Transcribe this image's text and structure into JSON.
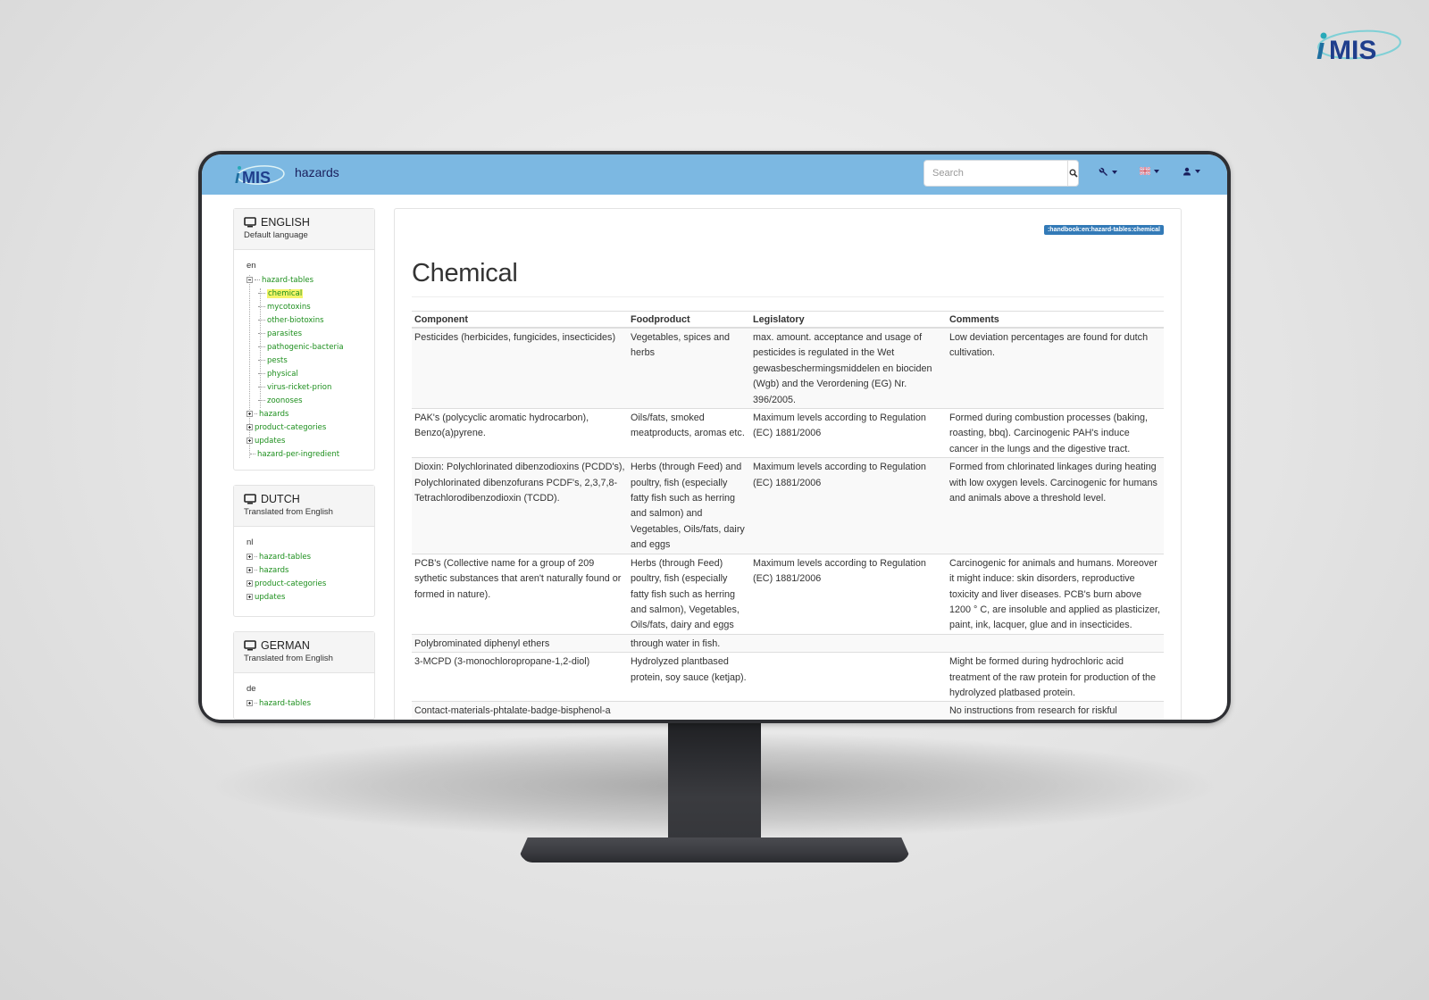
{
  "brand": {
    "name": "iMIS",
    "accent": "#1f3e8c",
    "navbar_color": "#7cb8e2"
  },
  "navbar": {
    "logo": "iMIS",
    "title": "hazards",
    "search": {
      "placeholder": "Search",
      "value": ""
    },
    "menus": [
      {
        "icon": "wrench-icon",
        "label": "Tools"
      },
      {
        "icon": "uk-flag-icon",
        "label": "Language"
      },
      {
        "icon": "user-icon",
        "label": "User"
      }
    ]
  },
  "sidebar": {
    "panels": [
      {
        "name": "ENGLISH",
        "subtitle": "Default language",
        "root": "en",
        "items": [
          {
            "label": "hazard-tables",
            "state": "expanded",
            "children": [
              "chemical",
              "mycotoxins",
              "other-biotoxins",
              "parasites",
              "pathogenic-bacteria",
              "pests",
              "physical",
              "virus-ricket-prion",
              "zoonoses"
            ]
          },
          {
            "label": "hazards",
            "state": "collapsed"
          },
          {
            "label": "product-categories",
            "state": "collapsed"
          },
          {
            "label": "updates",
            "state": "collapsed"
          },
          {
            "label": "hazard-per-ingredient",
            "state": "leaf"
          }
        ],
        "active_item": "chemical"
      },
      {
        "name": "DUTCH",
        "subtitle": "Translated from English",
        "root": "nl",
        "items": [
          {
            "label": "hazard-tables",
            "state": "collapsed"
          },
          {
            "label": "hazards",
            "state": "collapsed"
          },
          {
            "label": "product-categories",
            "state": "collapsed"
          },
          {
            "label": "updates",
            "state": "collapsed"
          }
        ]
      },
      {
        "name": "GERMAN",
        "subtitle": "Translated from English",
        "root": "de",
        "items": [
          {
            "label": "hazard-tables",
            "state": "collapsed"
          }
        ]
      }
    ]
  },
  "content": {
    "path_badge": ":handbook:en:hazard-tables:chemical",
    "title": "Chemical",
    "table": {
      "columns": [
        "Component",
        "Foodproduct",
        "Legislatory",
        "Comments"
      ],
      "rows": [
        [
          "Pesticides (herbicides, fungicides, insecticides)",
          "Vegetables, spices and herbs",
          "max. amount. acceptance and usage of pesticides is regulated in the Wet gewasbeschermingsmiddelen en biociden (Wgb) and the Verordening (EG) Nr. 396/2005.",
          "Low deviation percentages are found for dutch cultivation."
        ],
        [
          "PAK's (polycyclic aromatic hydrocarbon), Benzo(a)pyrene.",
          "Oils/fats, smoked meatproducts, aromas etc.",
          "Maximum levels according to Regulation (EC) 1881/2006",
          "Formed during combustion processes (baking, roasting, bbq). Carcinogenic PAH's induce cancer in the lungs and the digestive tract."
        ],
        [
          "Dioxin: Polychlorinated dibenzodioxins (PCDD's), Polychlorinated dibenzofurans PCDF's, 2,3,7,8-Tetrachlorodibenzodioxin (TCDD).",
          "Herbs (through Feed) and poultry, fish (especially fatty fish such as herring and salmon) and Vegetables, Oils/fats, dairy and eggs",
          "Maximum levels according to Regulation (EC) 1881/2006",
          "Formed from chlorinated linkages during heating with low oxygen levels. Carcinogenic for humans and animals above a threshold level."
        ],
        [
          "PCB's (Collective name for a group of 209 sythetic substances that aren't naturally found or formed in nature).",
          "Herbs (through Feed) poultry, fish (especially fatty fish such as herring and salmon), Vegetables, Oils/fats, dairy and eggs",
          "Maximum levels according to Regulation (EC) 1881/2006",
          "Carcinogenic for animals and humans. Moreover it might induce: skin disorders, reproductive toxicity and liver diseases. PCB's burn above 1200 ° C, are insoluble and applied as plasticizer, paint, ink, lacquer, glue and in insecticides."
        ],
        [
          "Polybrominated diphenyl ethers",
          "through water in fish.",
          "",
          ""
        ],
        [
          "3-MCPD (3-monochloropropane-1,2-diol)",
          "Hydrolyzed plantbased protein, soy sauce (ketjap).",
          "",
          "Might be formed during hydrochloric acid treatment of the raw protein for production of the hydrolyzed platbased protein."
        ],
        [
          "Contact-materials-phtalate-badge-bisphenol-a",
          "",
          "",
          "No instructions from research for riskful"
        ]
      ]
    }
  }
}
